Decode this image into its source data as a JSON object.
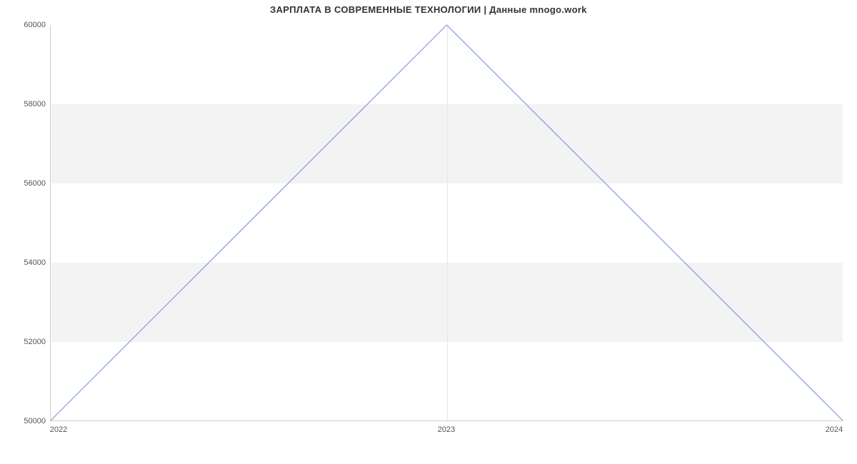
{
  "chart_data": {
    "type": "line",
    "title": "ЗАРПЛАТА В СОВРЕМЕННЫЕ ТЕХНОЛОГИИ | Данные mnogo.work",
    "xlabel": "",
    "ylabel": "",
    "categories": [
      "2022",
      "2023",
      "2024"
    ],
    "x": [
      2022,
      2023,
      2024
    ],
    "values": [
      50000,
      60000,
      50000
    ],
    "ylim": [
      50000,
      60000
    ],
    "yticks": [
      50000,
      52000,
      54000,
      56000,
      58000,
      60000
    ],
    "line_color": "#7d9fd3",
    "band_color": "#f3f3f3",
    "grid_bands": true
  }
}
